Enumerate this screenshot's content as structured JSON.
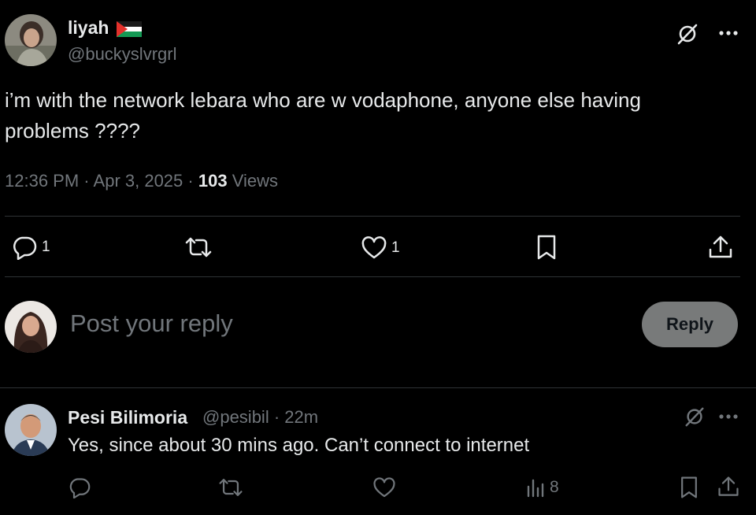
{
  "tweet": {
    "author_name": "liyah",
    "author_handle": "@buckyslvrgrl",
    "text": "i’m with the network lebara who are w vodaphone, anyone else having problems ????",
    "time": "12:36 PM",
    "date": "Apr 3, 2025",
    "views_count": "103",
    "views_label": "Views",
    "replies": "1",
    "likes": "1",
    "icons": [
      "palestine-flag",
      "grok-icon",
      "more-icon",
      "reply-icon",
      "retweet-icon",
      "like-icon",
      "bookmark-icon",
      "share-icon"
    ]
  },
  "composer": {
    "placeholder": "Post your reply",
    "button_label": "Reply"
  },
  "reply": {
    "author_name": "Pesi Bilimoria",
    "author_handle": "@pesibil",
    "separator": "·",
    "time": "22m",
    "text": "Yes, since about 30 mins ago. Can’t connect to internet",
    "views": "8"
  },
  "colors": {
    "background": "#000000",
    "text": "#e7e9ea",
    "muted": "#71767b",
    "divider": "#2f3336",
    "reply_button": "#787a7a"
  }
}
